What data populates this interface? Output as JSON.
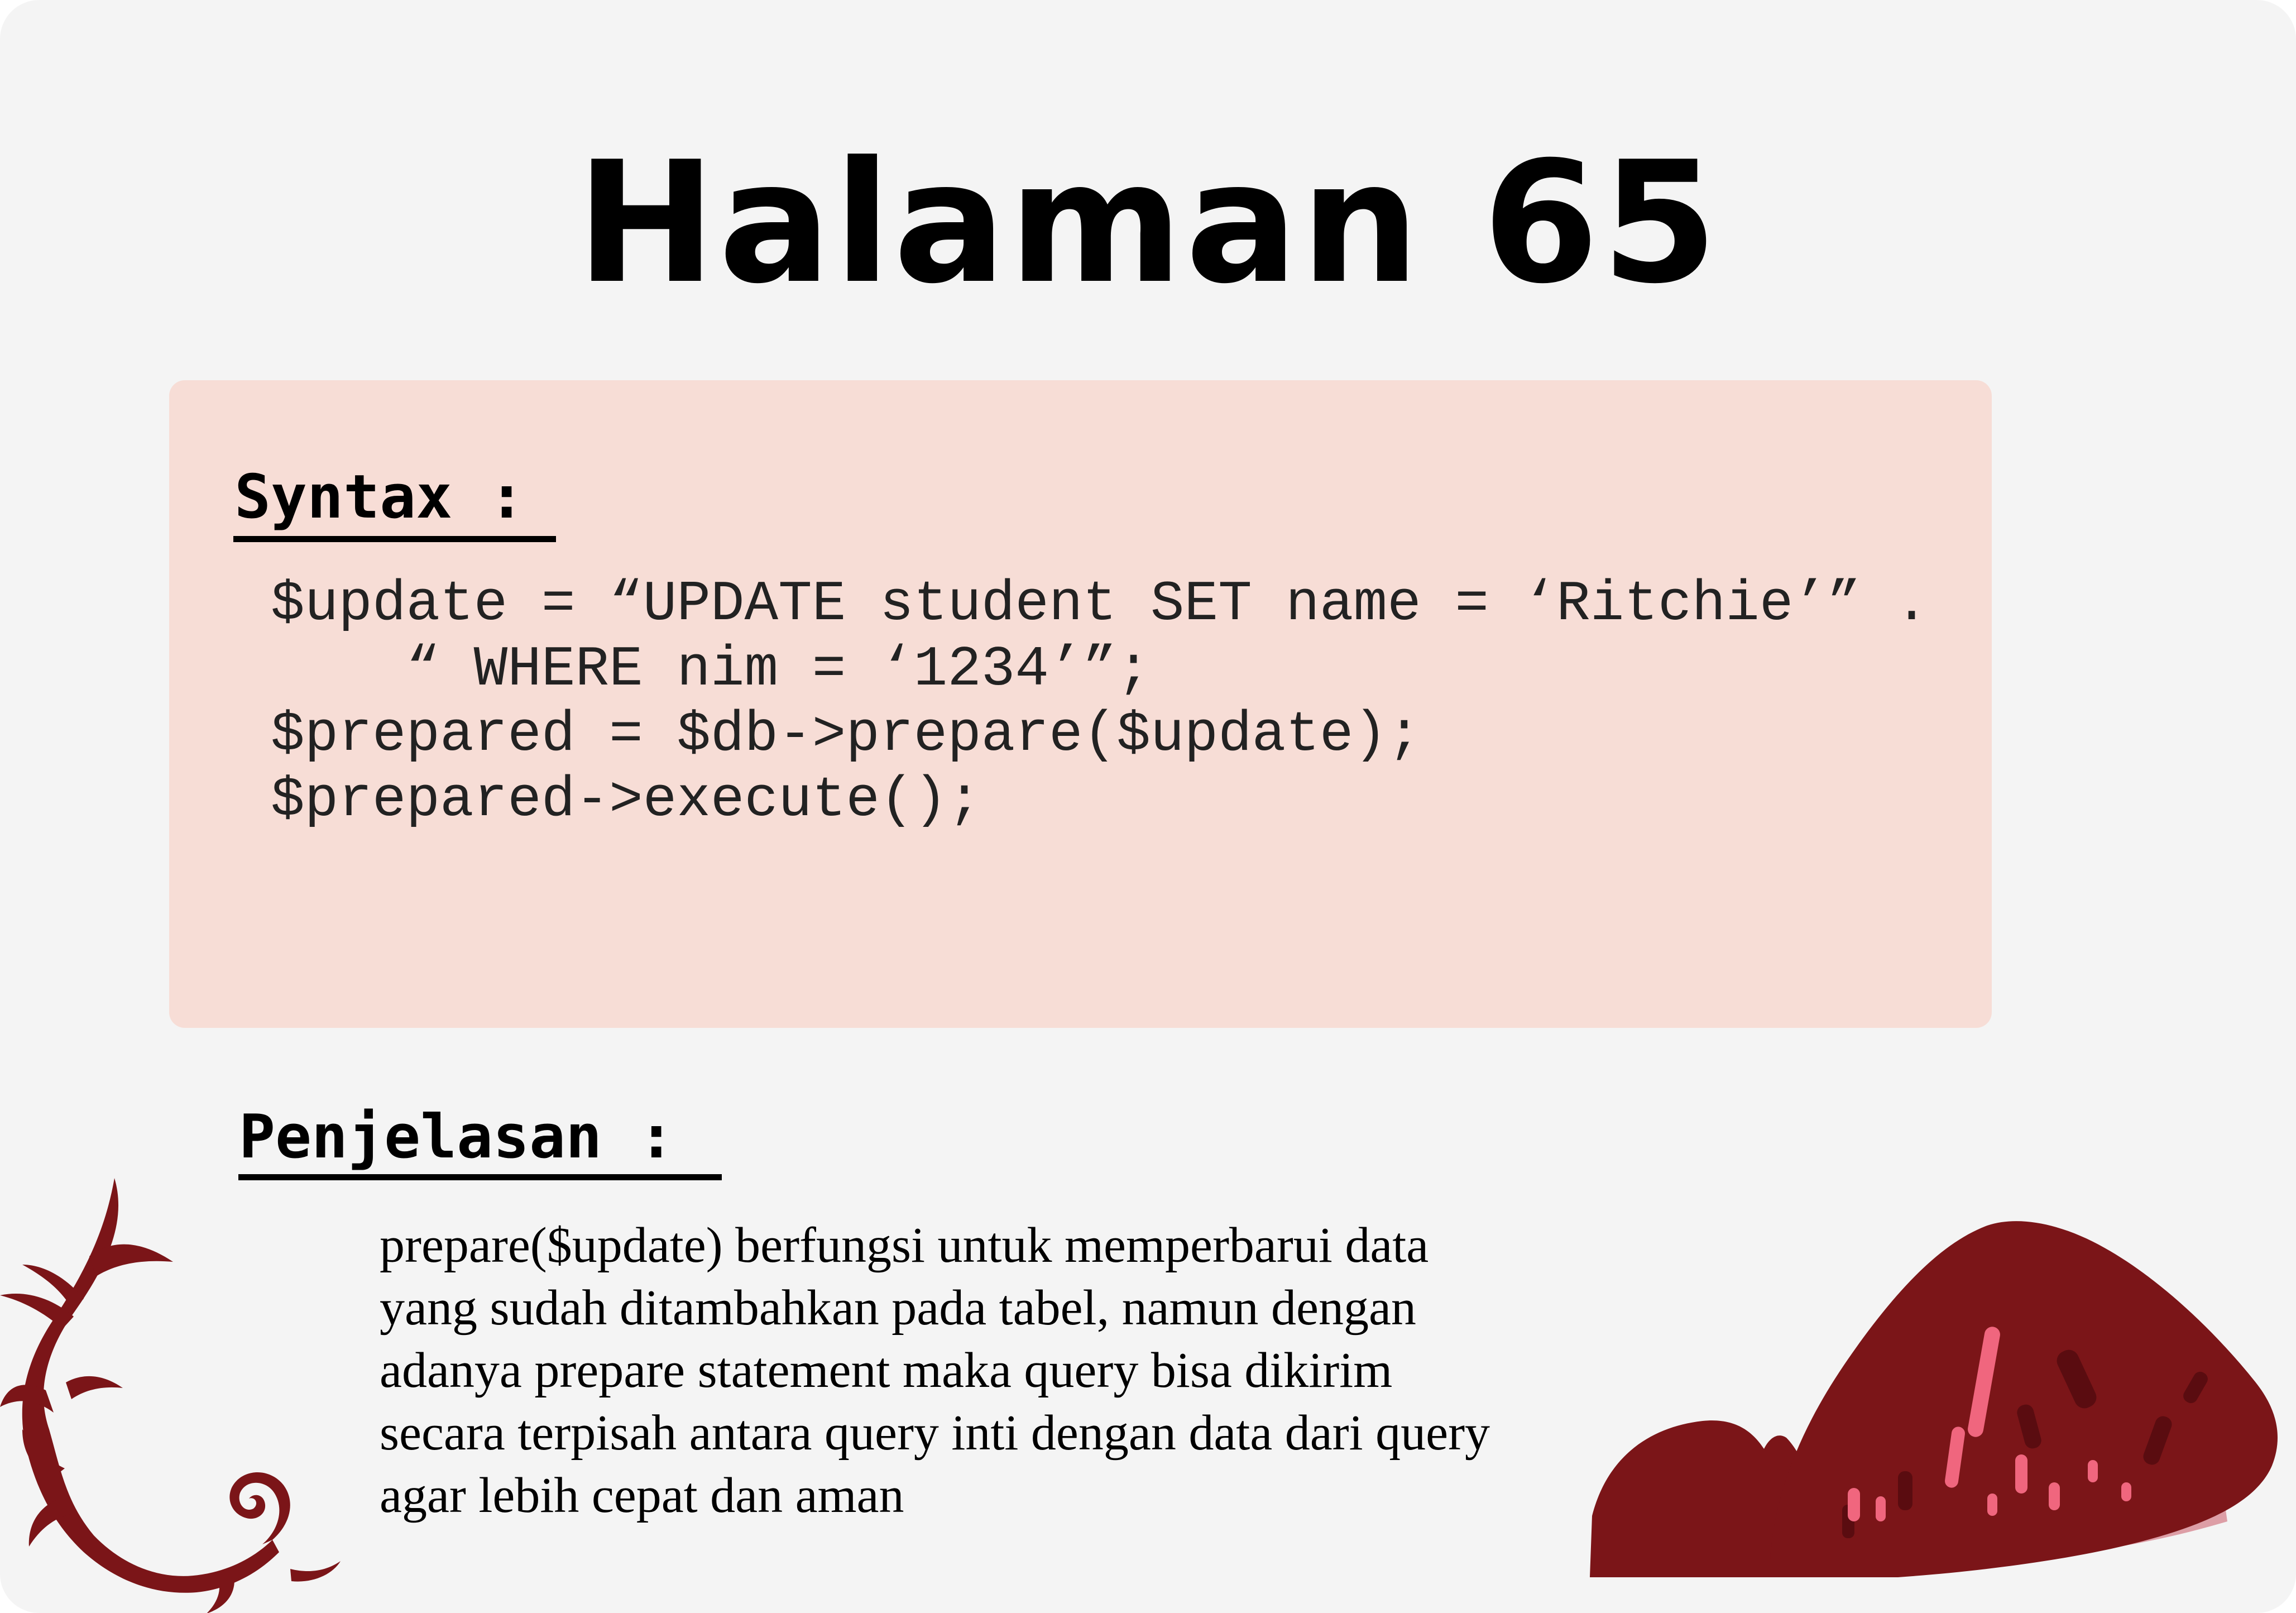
{
  "page": {
    "title": "Halaman 65"
  },
  "syntax": {
    "heading": "Syntax :",
    "code_lines": [
      "$update = “UPDATE student SET name = ‘Ritchie’” .",
      "    “ WHERE nim = ‘1234’”;",
      "$prepared = $db->prepare($update);",
      "$prepared->execute();"
    ]
  },
  "explanation": {
    "heading": "Penjelasan :",
    "lines": [
      "prepare($update) berfungsi untuk memperbarui data",
      "yang sudah ditambahkan pada tabel, namun dengan",
      "adanya prepare statement maka query bisa dikirim",
      "secara terpisah antara query inti dengan data dari query",
      "agar lebih cepat dan aman"
    ]
  },
  "decorations": {
    "left_ornament": "scroll-flourish-icon",
    "right_ornament": "red-rocks-illustration",
    "colors": {
      "maroon": "#7b1518",
      "pink": "#f0667e",
      "light_pink": "#dd9ea6",
      "syntax_background": "#f7ddd6",
      "page_background": "#f4f4f4"
    }
  }
}
